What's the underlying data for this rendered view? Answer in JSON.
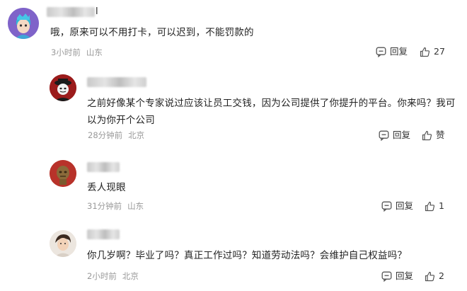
{
  "comments": [
    {
      "name_tail": "l",
      "text": "哦，原来可以不用打卡，可以迟到，不能罚款的",
      "time": "3小时前",
      "location": "山东",
      "reply_label": "回复",
      "like_label": "27",
      "avatar_icon": "cartoon-avatar-icon"
    },
    {
      "name_tail": "",
      "text": "之前好像某个专家说过应该让员工交钱，因为公司提供了你提升的平台。你来吗？我可\n以为你开个公司",
      "time": "28分钟前",
      "location": "北京",
      "reply_label": "回复",
      "like_label": "赞",
      "avatar_icon": "masked-figure-avatar-icon"
    },
    {
      "name_tail": "",
      "text": "丢人现眼",
      "time": "31分钟前",
      "location": "山东",
      "reply_label": "回复",
      "like_label": "1",
      "avatar_icon": "bronze-figure-avatar-icon"
    },
    {
      "name_tail": "",
      "text": "你几岁啊？毕业了吗？真正工作过吗？知道劳动法吗？会维护自己权益吗？",
      "time": "2小时前",
      "location": "北京",
      "reply_label": "回复",
      "like_label": "2",
      "avatar_icon": "photo-avatar-icon"
    }
  ],
  "colors": {
    "text": "#222222",
    "meta": "#999999",
    "icon": "#555555"
  }
}
